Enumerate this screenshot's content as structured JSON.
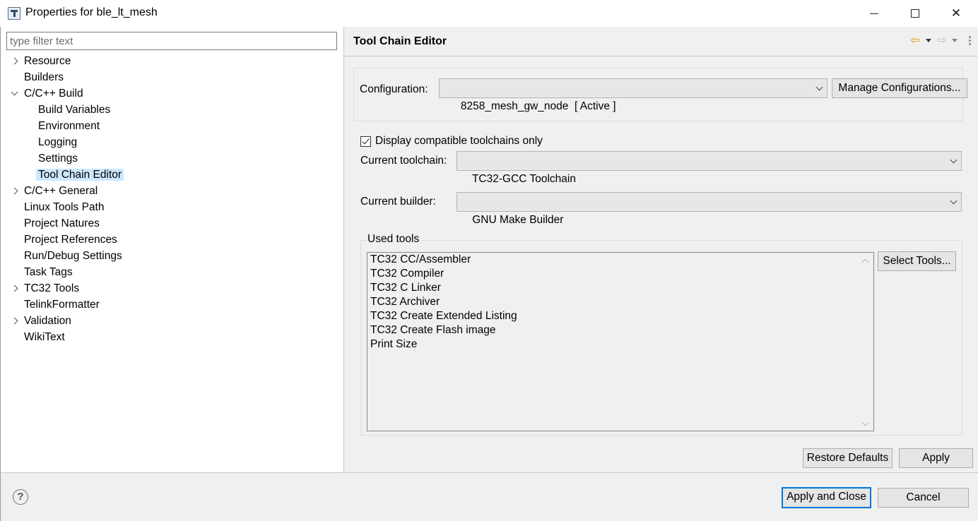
{
  "window": {
    "title": "Properties for ble_lt_mesh"
  },
  "filter": {
    "placeholder": "type filter text"
  },
  "tree": [
    {
      "label": "Resource",
      "level": 0,
      "expander": "closed"
    },
    {
      "label": "Builders",
      "level": 0,
      "expander": "none"
    },
    {
      "label": "C/C++ Build",
      "level": 0,
      "expander": "open"
    },
    {
      "label": "Build Variables",
      "level": 1,
      "expander": "none"
    },
    {
      "label": "Environment",
      "level": 1,
      "expander": "none"
    },
    {
      "label": "Logging",
      "level": 1,
      "expander": "none"
    },
    {
      "label": "Settings",
      "level": 1,
      "expander": "none"
    },
    {
      "label": "Tool Chain Editor",
      "level": 1,
      "expander": "none",
      "selected": true
    },
    {
      "label": "C/C++ General",
      "level": 0,
      "expander": "closed"
    },
    {
      "label": "Linux Tools Path",
      "level": 0,
      "expander": "none"
    },
    {
      "label": "Project Natures",
      "level": 0,
      "expander": "none"
    },
    {
      "label": "Project References",
      "level": 0,
      "expander": "none"
    },
    {
      "label": "Run/Debug Settings",
      "level": 0,
      "expander": "none"
    },
    {
      "label": "Task Tags",
      "level": 0,
      "expander": "none"
    },
    {
      "label": "TC32 Tools",
      "level": 0,
      "expander": "closed"
    },
    {
      "label": "TelinkFormatter",
      "level": 0,
      "expander": "none"
    },
    {
      "label": "Validation",
      "level": 0,
      "expander": "closed"
    },
    {
      "label": "WikiText",
      "level": 0,
      "expander": "none"
    }
  ],
  "page": {
    "title": "Tool Chain Editor",
    "configuration_label": "Configuration:",
    "configuration_value": "8258_mesh_gw_node  [ Active ]",
    "manage_configurations_label": "Manage Configurations...",
    "display_compatible_label": "Display compatible toolchains only",
    "display_compatible_checked": true,
    "current_toolchain_label": "Current toolchain:",
    "current_toolchain_value": "TC32-GCC Toolchain",
    "current_builder_label": "Current builder:",
    "current_builder_value": "GNU Make Builder",
    "used_tools_label": "Used tools",
    "used_tools": [
      "TC32 CC/Assembler",
      "TC32 Compiler",
      "TC32 C Linker",
      "TC32 Archiver",
      "TC32 Create Extended Listing",
      "TC32 Create Flash image",
      "Print Size"
    ],
    "select_tools_label": "Select Tools...",
    "restore_defaults_label": "Restore Defaults",
    "apply_label": "Apply"
  },
  "footer": {
    "help_glyph": "?",
    "apply_and_close_label": "Apply and Close",
    "cancel_label": "Cancel"
  },
  "colors": {
    "selection": "#cce8ff",
    "default_button_border": "#0078d7",
    "back_arrow": "#d49a00"
  },
  "icons": {
    "app": "tool-chain-app-icon",
    "back": "back-arrow-icon",
    "forward": "forward-arrow-icon",
    "menu": "view-menu-icon",
    "help": "help-icon"
  }
}
